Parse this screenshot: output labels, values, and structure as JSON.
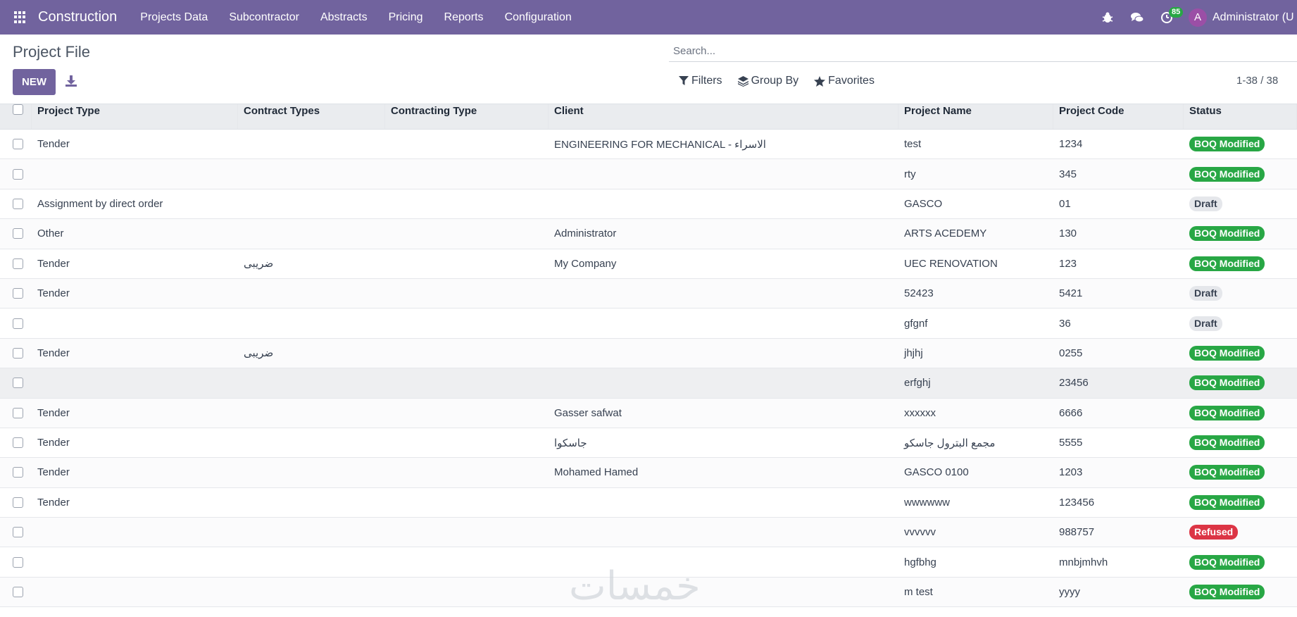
{
  "navbar": {
    "brand": "Construction",
    "menu": [
      "Projects Data",
      "Subcontractor",
      "Abstracts",
      "Pricing",
      "Reports",
      "Configuration"
    ],
    "activity_count": "85",
    "avatar_letter": "A",
    "user": "Administrator (U"
  },
  "page": {
    "title": "Project File",
    "new_label": "NEW",
    "search_placeholder": "Search...",
    "filters_label": "Filters",
    "group_by_label": "Group By",
    "favorites_label": "Favorites",
    "pager": "1-38 / 38"
  },
  "table": {
    "headers": [
      "Project Type",
      "Contract Types",
      "Contracting Type",
      "Client",
      "Project Name",
      "Project Code",
      "Status"
    ],
    "rows": [
      {
        "project_type": "Tender",
        "contract_types": "",
        "contracting_type": "",
        "client": "ENGINEERING FOR MECHANICAL - الاسراء",
        "project_name": "test",
        "project_code": "1234",
        "status": "BOQ Modified"
      },
      {
        "project_type": "",
        "contract_types": "",
        "contracting_type": "",
        "client": "",
        "project_name": "rty",
        "project_code": "345",
        "status": "BOQ Modified"
      },
      {
        "project_type": "Assignment by direct order",
        "contract_types": "",
        "contracting_type": "",
        "client": "",
        "project_name": "GASCO",
        "project_code": "01",
        "status": "Draft"
      },
      {
        "project_type": "Other",
        "contract_types": "",
        "contracting_type": "",
        "client": "Administrator",
        "project_name": "ARTS ACEDEMY",
        "project_code": "130",
        "status": "BOQ Modified"
      },
      {
        "project_type": "Tender",
        "contract_types": "ضريبى",
        "contracting_type": "",
        "client": "My Company",
        "project_name": "UEC RENOVATION",
        "project_code": "123",
        "status": "BOQ Modified"
      },
      {
        "project_type": "Tender",
        "contract_types": "",
        "contracting_type": "",
        "client": "",
        "project_name": "52423",
        "project_code": "5421",
        "status": "Draft"
      },
      {
        "project_type": "",
        "contract_types": "",
        "contracting_type": "",
        "client": "",
        "project_name": "gfgnf",
        "project_code": "36",
        "status": "Draft"
      },
      {
        "project_type": "Tender",
        "contract_types": "ضريبى",
        "contracting_type": "",
        "client": "",
        "project_name": "jhjhj",
        "project_code": "0255",
        "status": "BOQ Modified"
      },
      {
        "project_type": "",
        "contract_types": "",
        "contracting_type": "",
        "client": "",
        "project_name": "erfghj",
        "project_code": "23456",
        "status": "BOQ Modified"
      },
      {
        "project_type": "Tender",
        "contract_types": "",
        "contracting_type": "",
        "client": "Gasser safwat",
        "project_name": "xxxxxx",
        "project_code": "6666",
        "status": "BOQ Modified"
      },
      {
        "project_type": "Tender",
        "contract_types": "",
        "contracting_type": "",
        "client": "جاسكوا",
        "project_name": "مجمع البترول جاسكو",
        "project_code": "5555",
        "status": "BOQ Modified"
      },
      {
        "project_type": "Tender",
        "contract_types": "",
        "contracting_type": "",
        "client": "Mohamed Hamed",
        "project_name": "GASCO 0100",
        "project_code": "1203",
        "status": "BOQ Modified"
      },
      {
        "project_type": "Tender",
        "contract_types": "",
        "contracting_type": "",
        "client": "",
        "project_name": "wwwwww",
        "project_code": "123456",
        "status": "BOQ Modified"
      },
      {
        "project_type": "",
        "contract_types": "",
        "contracting_type": "",
        "client": "",
        "project_name": "vvvvvv",
        "project_code": "988757",
        "status": "Refused"
      },
      {
        "project_type": "",
        "contract_types": "",
        "contracting_type": "",
        "client": "",
        "project_name": "hgfbhg",
        "project_code": "mnbjmhvh",
        "status": "BOQ Modified"
      },
      {
        "project_type": "",
        "contract_types": "",
        "contracting_type": "",
        "client": "",
        "project_name": "m test",
        "project_code": "yyyy",
        "status": "BOQ Modified"
      }
    ]
  },
  "colors": {
    "navbar": "#71639e",
    "boq_modified": "#28a745",
    "draft": "#e5e7eb",
    "refused": "#dc3545"
  },
  "watermark": "خمسات"
}
